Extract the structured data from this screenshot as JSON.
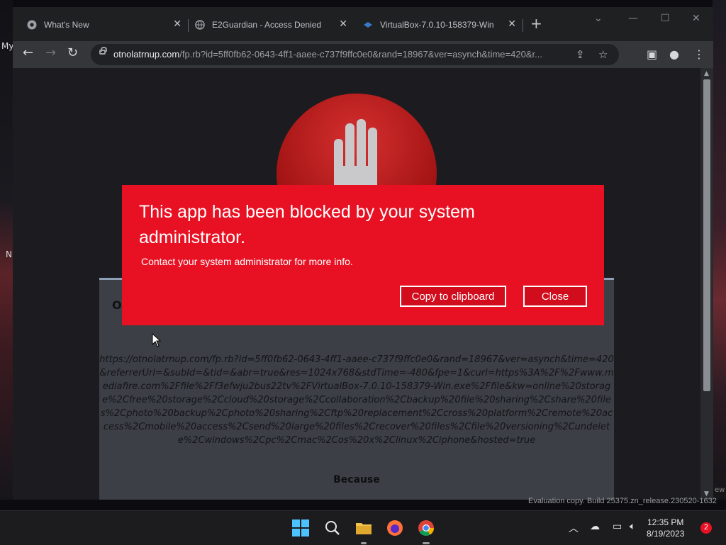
{
  "desktop": {
    "left_text_top": "My",
    "left_text_mid": "N",
    "eval_text": "Evaluation copy. Build 25375.zn_release.230520-1632",
    "right_edge_text": "ew"
  },
  "browser": {
    "tabs": [
      {
        "title": "What's New",
        "icon": "chrome-icon"
      },
      {
        "title": "E2Guardian - Access Denied",
        "icon": "globe-icon"
      },
      {
        "title": "VirtualBox-7.0.10-158379-Win",
        "icon": "virtualbox-icon"
      }
    ],
    "url_host": "otnolatrnup.com",
    "url_path": "/fp.rb?id=5ff0fb62-0643-4ff1-aaee-c737f9ffc0e0&rand=18967&ver=asynch&time=420&r..."
  },
  "page": {
    "card_heading": "O",
    "blocked_url": "https://otnolatrnup.com/fp.rb?id=5ff0fb62-0643-4ff1-aaee-c737f9ffc0e0&rand=18967&ver=asynch&time=420&referrerUrl=&subId=&tid=&abr=true&res=1024x768&stdTime=-480&fpe=1&curl=https%3A%2F%2Fwww.mediafire.com%2Ffile%2Ff3efwju2bus22tv%2FVirtualBox-7.0.10-158379-Win.exe%2Ffile&kw=online%20storage%2Cfree%20storage%2Ccloud%20storage%2Ccollaboration%2Cbackup%20file%20sharing%2Cshare%20files%2Cphoto%20backup%2Cphoto%20sharing%2Cftp%20replacement%2Ccross%20platform%2Cremote%20access%2Cmobile%20access%2Csend%20large%20files%2Crecover%20files%2Cfile%20versioning%2Cundelete%2Cwindows%2Cpc%2Cmac%2Cos%20x%2Clinux%2Ciphone&hosted=true",
    "because_label": "Because"
  },
  "dialog": {
    "title": "This app has been blocked by your system administrator.",
    "subtitle": "Contact your system administrator for more info.",
    "copy_label": "Copy to clipboard",
    "close_label": "Close"
  },
  "taskbar": {
    "time": "12:35 PM",
    "date": "8/19/2023",
    "notifications": "2"
  }
}
